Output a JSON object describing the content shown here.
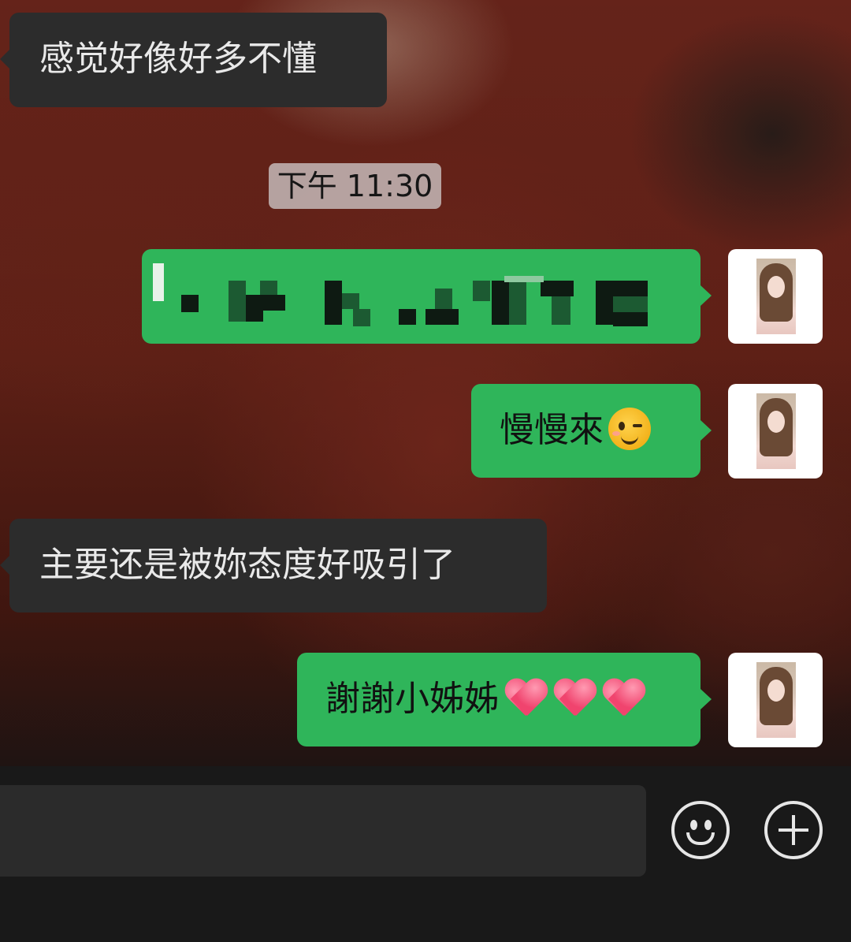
{
  "chat": {
    "timestamp": "下午 11:30",
    "messages": [
      {
        "direction": "incoming",
        "text": "感觉好像好多不懂"
      },
      {
        "direction": "outgoing",
        "text": "",
        "note_visible": "pixelated-censored"
      },
      {
        "direction": "outgoing",
        "text": "慢慢來",
        "emoji": "winking-face"
      },
      {
        "direction": "incoming",
        "text": "主要还是被妳态度好吸引了"
      },
      {
        "direction": "outgoing",
        "text": "謝謝小姊姊",
        "emoji": "heart x3"
      }
    ]
  },
  "input_bar": {
    "placeholder": "",
    "icons": [
      "emoji-icon",
      "plus-icon"
    ]
  },
  "colors": {
    "outgoing_bubble": "#2fb55a",
    "incoming_bubble": "#2c2c2c",
    "input_bar_bg": "#191919"
  }
}
